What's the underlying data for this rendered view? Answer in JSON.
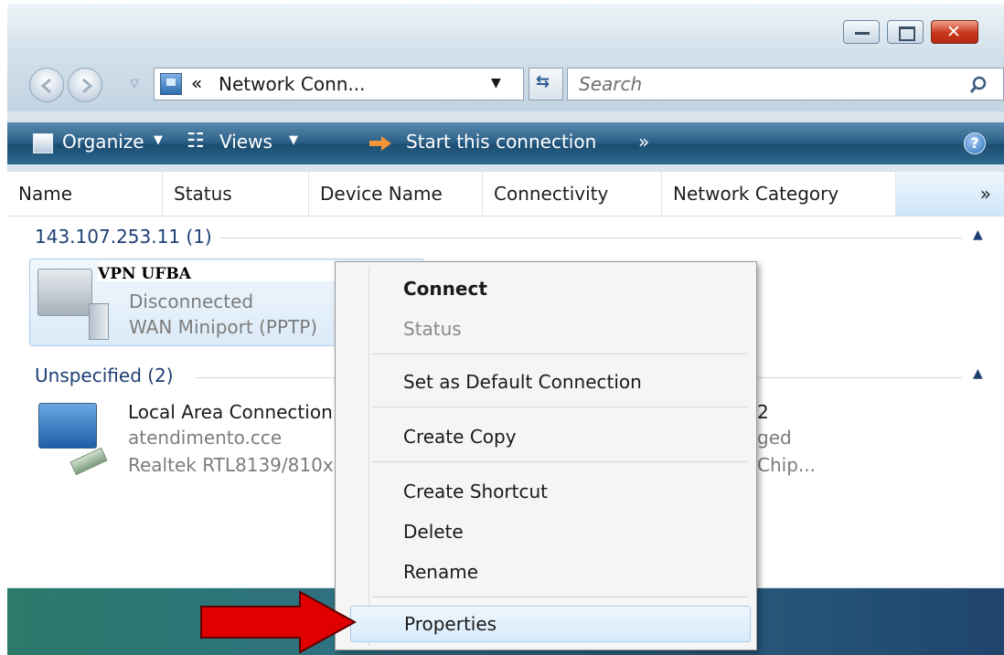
{
  "window": {
    "address_text": "Network Conn...",
    "address_chevron": "«",
    "search_placeholder": "Search"
  },
  "toolbar": {
    "organize": "Organize",
    "views": "Views",
    "start_connection": "Start this connection",
    "more": "»"
  },
  "columns": [
    "Name",
    "Status",
    "Device Name",
    "Connectivity",
    "Network Category"
  ],
  "columns_more": "»",
  "groups": [
    {
      "header": "143.107.253.11 (1)",
      "items": [
        {
          "name": "VPN UFBA",
          "status": "Disconnected",
          "device": "WAN Miniport (PPTP)"
        }
      ]
    },
    {
      "header": "Unspecified (2)",
      "items": [
        {
          "name": "Local Area Connection",
          "status": "atendimento.cce",
          "device": "Realtek RTL8139/810x"
        },
        {
          "name": "2",
          "status": "ged",
          "device": "Chip..."
        }
      ]
    }
  ],
  "context_menu": {
    "connect": "Connect",
    "status": "Status",
    "set_default": "Set as Default Connection",
    "create_copy": "Create Copy",
    "create_shortcut": "Create Shortcut",
    "delete": "Delete",
    "rename": "Rename",
    "properties": "Properties"
  },
  "colors": {
    "toolbar": "#2d6289",
    "group_header": "#1e3f73",
    "arrow": "#e00000"
  }
}
